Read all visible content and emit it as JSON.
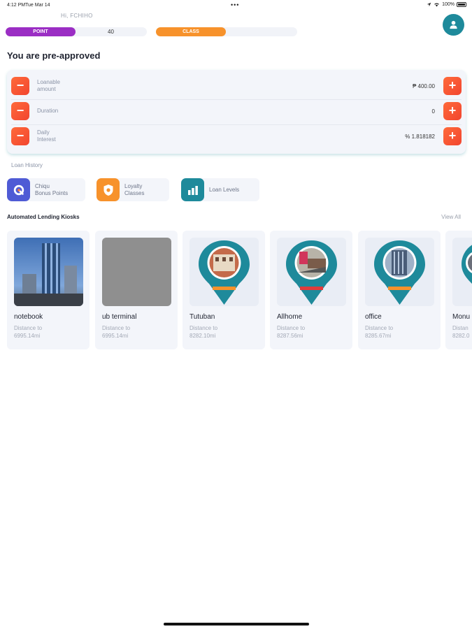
{
  "status": {
    "time": "4:12 PM",
    "date": "Tue Mar 14",
    "battery": "100%",
    "dots": "•••"
  },
  "header": {
    "greeting": "Hi, FCHIHO",
    "point_label": "POINT",
    "point_value": "40",
    "class_label": "CLASS",
    "class_value": ""
  },
  "title": "You are pre-approved",
  "loan": {
    "rows": [
      {
        "label_line1": "Loanable",
        "label_line2": "amount",
        "value": "₱ 400.00"
      },
      {
        "label_line1": "Duration",
        "label_line2": "",
        "value": "0"
      },
      {
        "label_line1": "Daily",
        "label_line2": "Interest",
        "value": "% 1.818182"
      }
    ],
    "minus": "−",
    "plus": "+"
  },
  "history_label": "Loan History",
  "shortcuts": [
    {
      "line1": "Chiqu",
      "line2": "Bonus Points",
      "icon": "chiqu-logo-icon"
    },
    {
      "line1": "Loyalty",
      "line2": "Classes",
      "icon": "shield-icon"
    },
    {
      "line1": "Loan Levels",
      "line2": "",
      "icon": "bar-chart-icon"
    }
  ],
  "kiosks_heading": "Automated Lending Kiosks",
  "view_all": "View All",
  "kiosks": [
    {
      "name": "notebook",
      "dist_label": "Distance to",
      "dist": "6995.14mi"
    },
    {
      "name": "ub terminal",
      "dist_label": "Distance to",
      "dist": "6995.14mi"
    },
    {
      "name": "Tutuban",
      "dist_label": "Distance to",
      "dist": "8282.10mi"
    },
    {
      "name": "Allhome",
      "dist_label": "Distance to",
      "dist": "8287.56mi"
    },
    {
      "name": "office",
      "dist_label": "Distance to",
      "dist": "8285.67mi"
    },
    {
      "name": "Monu",
      "dist_label": "Distan",
      "dist": "8282.0"
    }
  ],
  "colors": {
    "accent_teal": "#1e8a9b",
    "point_purple": "#9b2ec4",
    "class_orange": "#f7922b",
    "button_red": "#f2452f"
  }
}
